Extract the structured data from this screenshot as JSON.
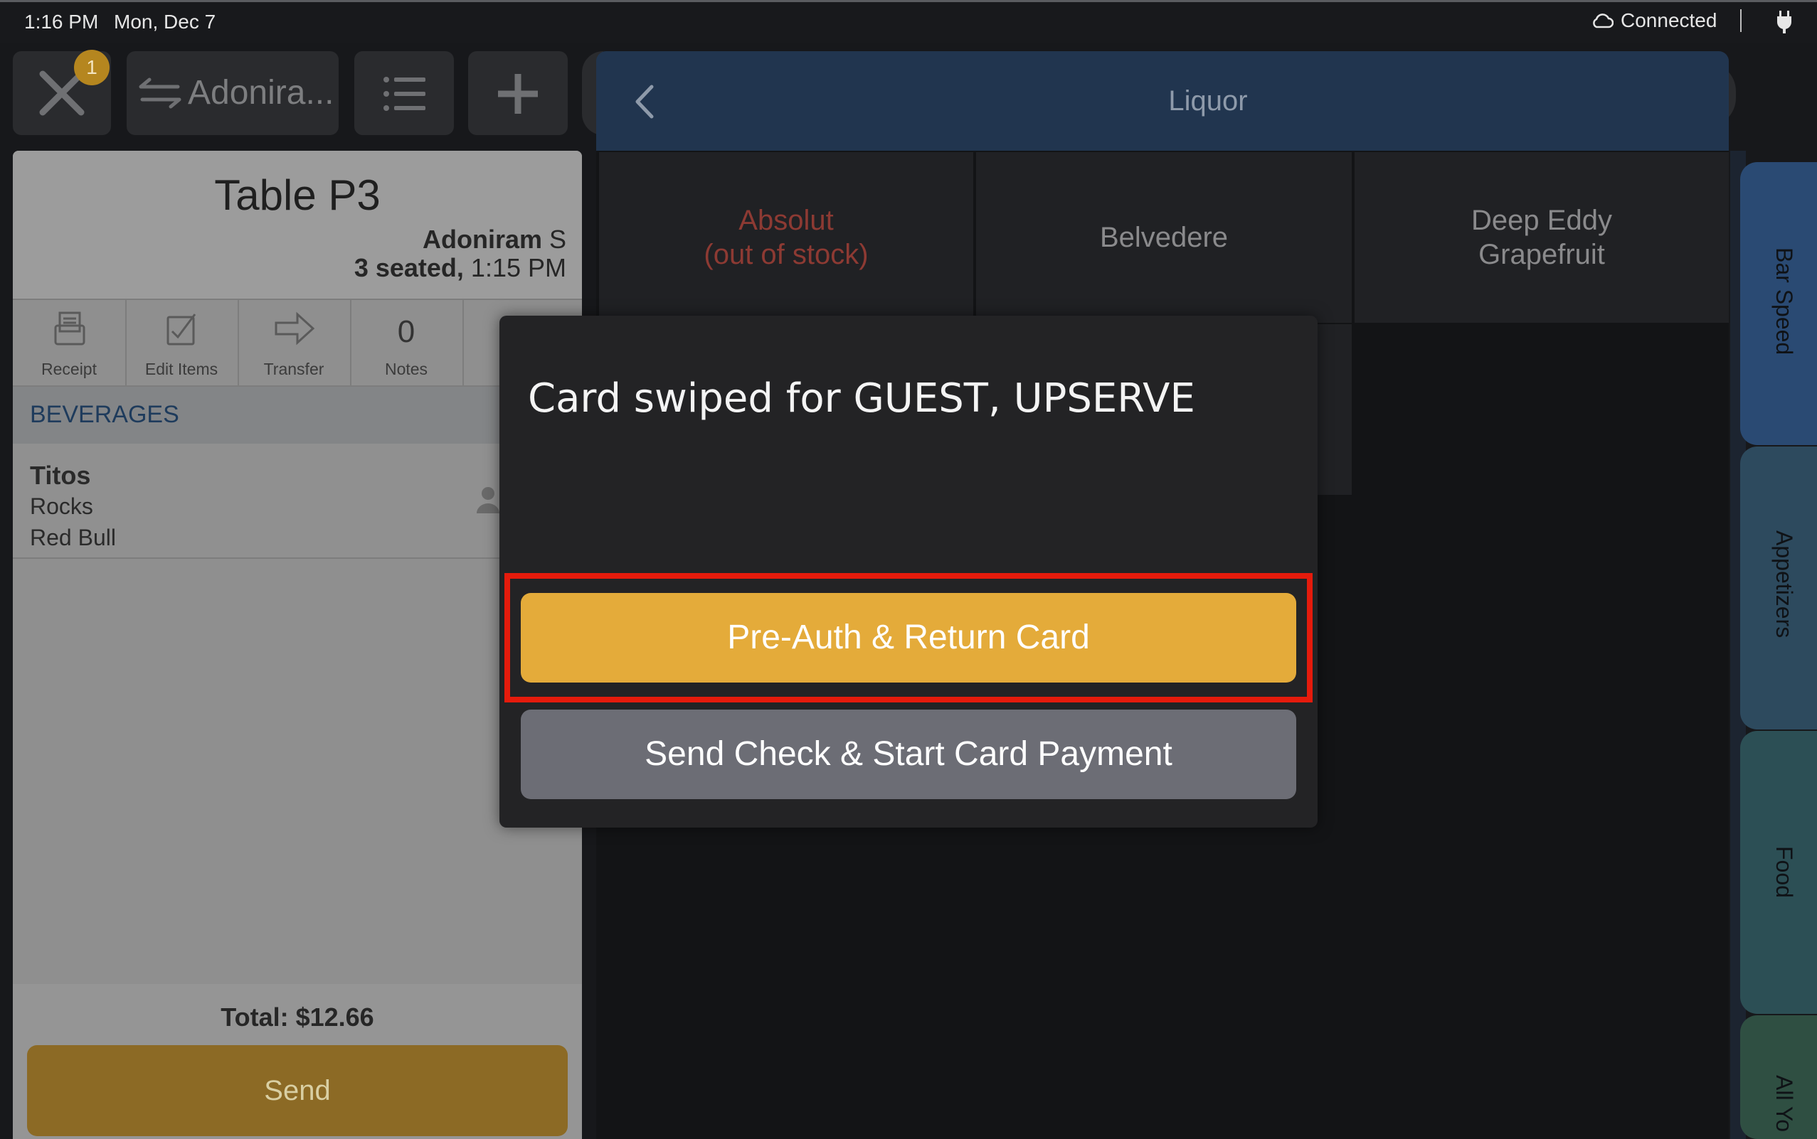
{
  "status_bar": {
    "time": "1:16 PM",
    "date": "Mon, Dec 7",
    "connection": "Connected"
  },
  "toolbar": {
    "close_badge": "1",
    "server_label": "Adonira..."
  },
  "check": {
    "table_name": "Table P3",
    "server_name": "Adoniram",
    "server_suffix": " S",
    "seated_count": "3 seated,",
    "seated_time": " 1:15 PM",
    "actions": [
      {
        "label": "Receipt"
      },
      {
        "label": "Edit Items"
      },
      {
        "label": "Transfer"
      },
      {
        "label": "Notes",
        "count": "0"
      }
    ],
    "section_title": "BEVERAGES",
    "items": [
      {
        "name": "Titos",
        "modifiers": [
          "Rocks",
          "Red Bull"
        ]
      }
    ],
    "total": "Total: $12.66",
    "send_label": "Send"
  },
  "menu": {
    "category_title": "Liquor",
    "tiles": [
      {
        "line1": "Absolut",
        "line2": "(out of stock)",
        "status": "out_of_stock"
      },
      {
        "line1": "Belvedere",
        "line2": ""
      },
      {
        "line1": "Deep Eddy",
        "line2": "Grapefruit"
      }
    ]
  },
  "side_tabs": [
    {
      "label": "Bar Speed",
      "color": "#2a4a73"
    },
    {
      "label": "Appetizers",
      "color": "#2d4a5e"
    },
    {
      "label": "Food",
      "color": "#2c4f55"
    },
    {
      "label": "All Yo",
      "color": "#2f4f42"
    }
  ],
  "dialog": {
    "message": "Card swiped for GUEST, UPSERVE",
    "primary_button": "Pre-Auth & Return Card",
    "secondary_button": "Send Check & Start Card Payment",
    "highlight_color": "#e51b0c"
  }
}
